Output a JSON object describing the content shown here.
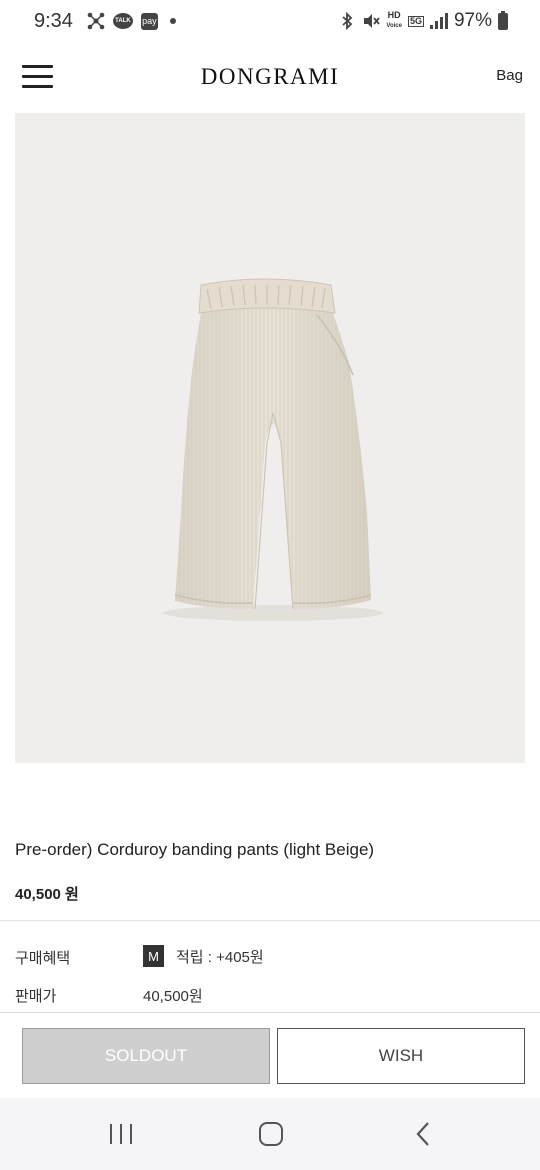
{
  "status_bar": {
    "time": "9:34",
    "talk_label": "TALK",
    "pay_label": "pay",
    "network_hd": "HD",
    "network_voice": "Voice",
    "network_5g": "5G",
    "battery": "97%"
  },
  "header": {
    "logo": "DONGRAMI",
    "bag_label": "Bag"
  },
  "product": {
    "image_alt": "light beige corduroy banding pants",
    "background_color": "#f0eeec",
    "title": "Pre-order) Corduroy banding pants (light Beige)",
    "price": "40,500 원"
  },
  "info": {
    "benefit_label": "구매혜택",
    "benefit_badge": "M",
    "benefit_value": "적립 : +405원",
    "sale_price_label": "판매가",
    "sale_price_value": "40,500원"
  },
  "actions": {
    "soldout_label": "SOLDOUT",
    "wish_label": "WISH"
  },
  "nav": {
    "recent_icon": "recent-apps-icon",
    "home_icon": "home-icon",
    "back_icon": "back-icon"
  }
}
